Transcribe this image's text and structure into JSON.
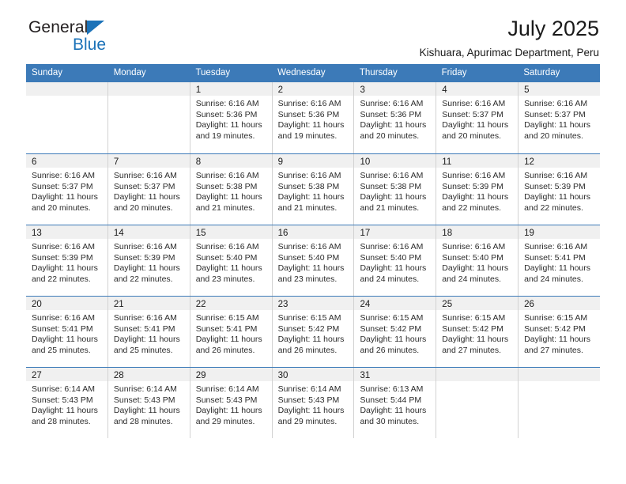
{
  "brand": {
    "name_primary": "General",
    "name_secondary": "Blue",
    "triangle_color": "#1b72b8"
  },
  "header": {
    "title": "July 2025",
    "subtitle": "Kishuara, Apurimac Department, Peru"
  },
  "theme": {
    "header_blue": "#3c7ab8",
    "daynum_bg": "#f0f0f0",
    "cell_border": "#d2d2d2"
  },
  "weekdays": [
    "Sunday",
    "Monday",
    "Tuesday",
    "Wednesday",
    "Thursday",
    "Friday",
    "Saturday"
  ],
  "weeks": [
    [
      {
        "day": "",
        "empty": true
      },
      {
        "day": "",
        "empty": true
      },
      {
        "day": "1",
        "sunrise": "Sunrise: 6:16 AM",
        "sunset": "Sunset: 5:36 PM",
        "daylight": "Daylight: 11 hours and 19 minutes."
      },
      {
        "day": "2",
        "sunrise": "Sunrise: 6:16 AM",
        "sunset": "Sunset: 5:36 PM",
        "daylight": "Daylight: 11 hours and 19 minutes."
      },
      {
        "day": "3",
        "sunrise": "Sunrise: 6:16 AM",
        "sunset": "Sunset: 5:36 PM",
        "daylight": "Daylight: 11 hours and 20 minutes."
      },
      {
        "day": "4",
        "sunrise": "Sunrise: 6:16 AM",
        "sunset": "Sunset: 5:37 PM",
        "daylight": "Daylight: 11 hours and 20 minutes."
      },
      {
        "day": "5",
        "sunrise": "Sunrise: 6:16 AM",
        "sunset": "Sunset: 5:37 PM",
        "daylight": "Daylight: 11 hours and 20 minutes."
      }
    ],
    [
      {
        "day": "6",
        "sunrise": "Sunrise: 6:16 AM",
        "sunset": "Sunset: 5:37 PM",
        "daylight": "Daylight: 11 hours and 20 minutes."
      },
      {
        "day": "7",
        "sunrise": "Sunrise: 6:16 AM",
        "sunset": "Sunset: 5:37 PM",
        "daylight": "Daylight: 11 hours and 20 minutes."
      },
      {
        "day": "8",
        "sunrise": "Sunrise: 6:16 AM",
        "sunset": "Sunset: 5:38 PM",
        "daylight": "Daylight: 11 hours and 21 minutes."
      },
      {
        "day": "9",
        "sunrise": "Sunrise: 6:16 AM",
        "sunset": "Sunset: 5:38 PM",
        "daylight": "Daylight: 11 hours and 21 minutes."
      },
      {
        "day": "10",
        "sunrise": "Sunrise: 6:16 AM",
        "sunset": "Sunset: 5:38 PM",
        "daylight": "Daylight: 11 hours and 21 minutes."
      },
      {
        "day": "11",
        "sunrise": "Sunrise: 6:16 AM",
        "sunset": "Sunset: 5:39 PM",
        "daylight": "Daylight: 11 hours and 22 minutes."
      },
      {
        "day": "12",
        "sunrise": "Sunrise: 6:16 AM",
        "sunset": "Sunset: 5:39 PM",
        "daylight": "Daylight: 11 hours and 22 minutes."
      }
    ],
    [
      {
        "day": "13",
        "sunrise": "Sunrise: 6:16 AM",
        "sunset": "Sunset: 5:39 PM",
        "daylight": "Daylight: 11 hours and 22 minutes."
      },
      {
        "day": "14",
        "sunrise": "Sunrise: 6:16 AM",
        "sunset": "Sunset: 5:39 PM",
        "daylight": "Daylight: 11 hours and 22 minutes."
      },
      {
        "day": "15",
        "sunrise": "Sunrise: 6:16 AM",
        "sunset": "Sunset: 5:40 PM",
        "daylight": "Daylight: 11 hours and 23 minutes."
      },
      {
        "day": "16",
        "sunrise": "Sunrise: 6:16 AM",
        "sunset": "Sunset: 5:40 PM",
        "daylight": "Daylight: 11 hours and 23 minutes."
      },
      {
        "day": "17",
        "sunrise": "Sunrise: 6:16 AM",
        "sunset": "Sunset: 5:40 PM",
        "daylight": "Daylight: 11 hours and 24 minutes."
      },
      {
        "day": "18",
        "sunrise": "Sunrise: 6:16 AM",
        "sunset": "Sunset: 5:40 PM",
        "daylight": "Daylight: 11 hours and 24 minutes."
      },
      {
        "day": "19",
        "sunrise": "Sunrise: 6:16 AM",
        "sunset": "Sunset: 5:41 PM",
        "daylight": "Daylight: 11 hours and 24 minutes."
      }
    ],
    [
      {
        "day": "20",
        "sunrise": "Sunrise: 6:16 AM",
        "sunset": "Sunset: 5:41 PM",
        "daylight": "Daylight: 11 hours and 25 minutes."
      },
      {
        "day": "21",
        "sunrise": "Sunrise: 6:16 AM",
        "sunset": "Sunset: 5:41 PM",
        "daylight": "Daylight: 11 hours and 25 minutes."
      },
      {
        "day": "22",
        "sunrise": "Sunrise: 6:15 AM",
        "sunset": "Sunset: 5:41 PM",
        "daylight": "Daylight: 11 hours and 26 minutes."
      },
      {
        "day": "23",
        "sunrise": "Sunrise: 6:15 AM",
        "sunset": "Sunset: 5:42 PM",
        "daylight": "Daylight: 11 hours and 26 minutes."
      },
      {
        "day": "24",
        "sunrise": "Sunrise: 6:15 AM",
        "sunset": "Sunset: 5:42 PM",
        "daylight": "Daylight: 11 hours and 26 minutes."
      },
      {
        "day": "25",
        "sunrise": "Sunrise: 6:15 AM",
        "sunset": "Sunset: 5:42 PM",
        "daylight": "Daylight: 11 hours and 27 minutes."
      },
      {
        "day": "26",
        "sunrise": "Sunrise: 6:15 AM",
        "sunset": "Sunset: 5:42 PM",
        "daylight": "Daylight: 11 hours and 27 minutes."
      }
    ],
    [
      {
        "day": "27",
        "sunrise": "Sunrise: 6:14 AM",
        "sunset": "Sunset: 5:43 PM",
        "daylight": "Daylight: 11 hours and 28 minutes."
      },
      {
        "day": "28",
        "sunrise": "Sunrise: 6:14 AM",
        "sunset": "Sunset: 5:43 PM",
        "daylight": "Daylight: 11 hours and 28 minutes."
      },
      {
        "day": "29",
        "sunrise": "Sunrise: 6:14 AM",
        "sunset": "Sunset: 5:43 PM",
        "daylight": "Daylight: 11 hours and 29 minutes."
      },
      {
        "day": "30",
        "sunrise": "Sunrise: 6:14 AM",
        "sunset": "Sunset: 5:43 PM",
        "daylight": "Daylight: 11 hours and 29 minutes."
      },
      {
        "day": "31",
        "sunrise": "Sunrise: 6:13 AM",
        "sunset": "Sunset: 5:44 PM",
        "daylight": "Daylight: 11 hours and 30 minutes."
      },
      {
        "day": "",
        "empty": true
      },
      {
        "day": "",
        "empty": true
      }
    ]
  ]
}
